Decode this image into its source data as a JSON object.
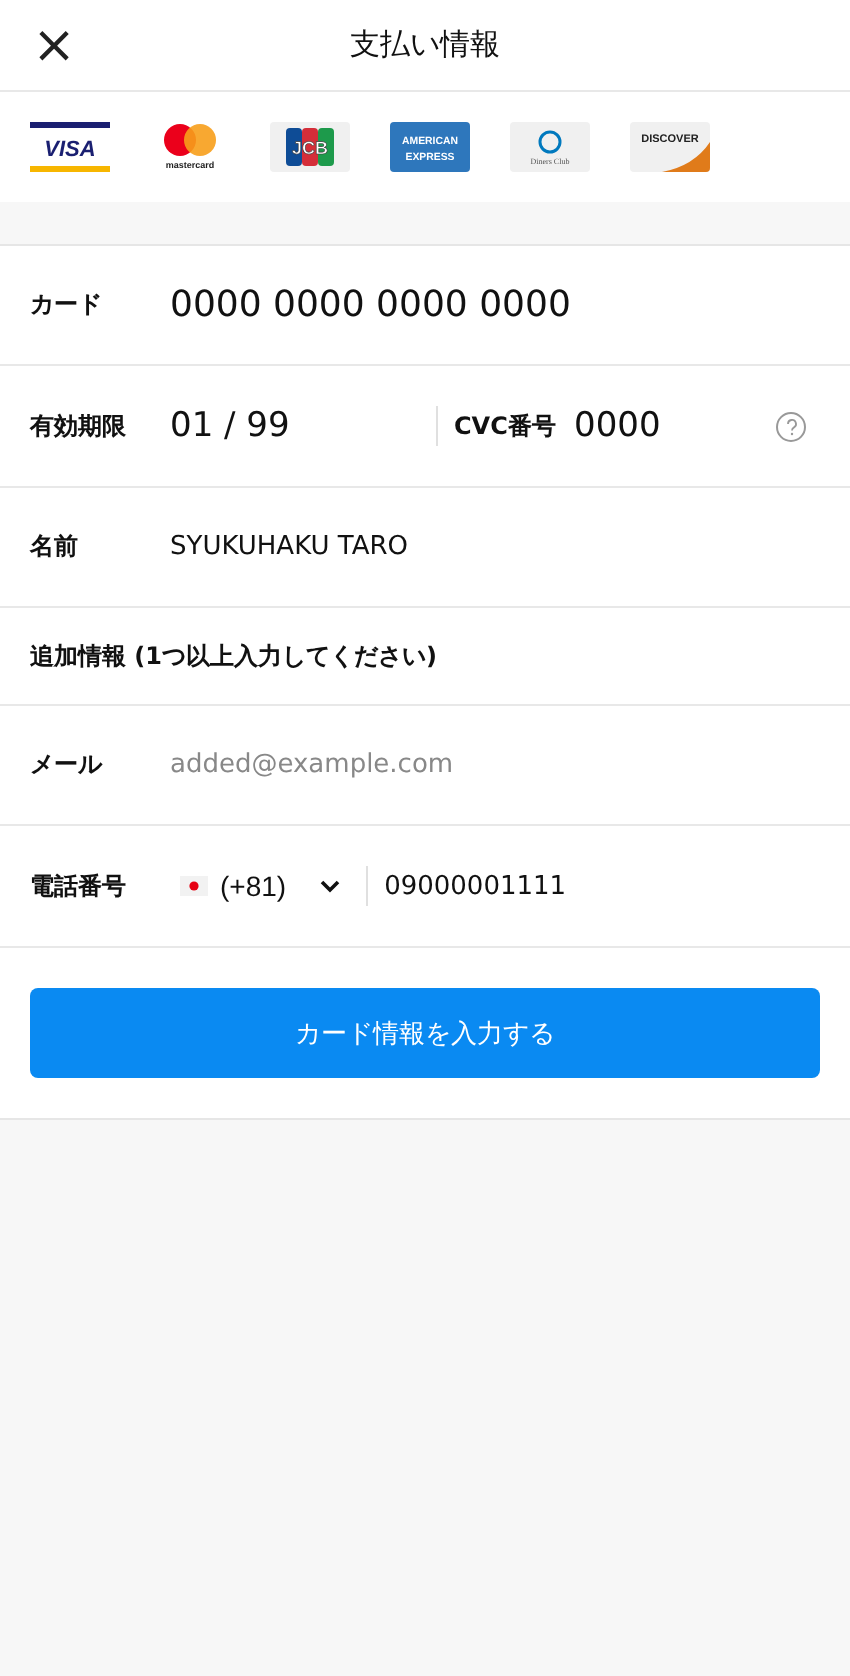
{
  "header": {
    "close_icon": "×",
    "title": "支払い情報"
  },
  "card_brands": [
    {
      "kind": "visa",
      "label": "VISA"
    },
    {
      "kind": "mastercard",
      "label": "mastercard"
    },
    {
      "kind": "jcb",
      "label": "JCB"
    },
    {
      "kind": "amex",
      "label": "AMERICAN EXPRESS"
    },
    {
      "kind": "diners",
      "label": "Diners Club"
    },
    {
      "kind": "discover",
      "label": "DISCOVER"
    }
  ],
  "card": {
    "label": "カード",
    "value": "0000 0000 0000 0000"
  },
  "expiry": {
    "label": "有効期限",
    "value": "01 / 99"
  },
  "cvc": {
    "label": "CVC番号",
    "value": "0000"
  },
  "name": {
    "label": "名前",
    "value": "SYUKUHAKU TARO"
  },
  "extra_heading": "追加情報 (1つ以上入力してください)",
  "email": {
    "label": "メール",
    "placeholder": "added@example.com"
  },
  "phone": {
    "label": "電話番号",
    "country_code": "(+81)",
    "value": "09000001111"
  },
  "submit": "カード情報を入力する"
}
